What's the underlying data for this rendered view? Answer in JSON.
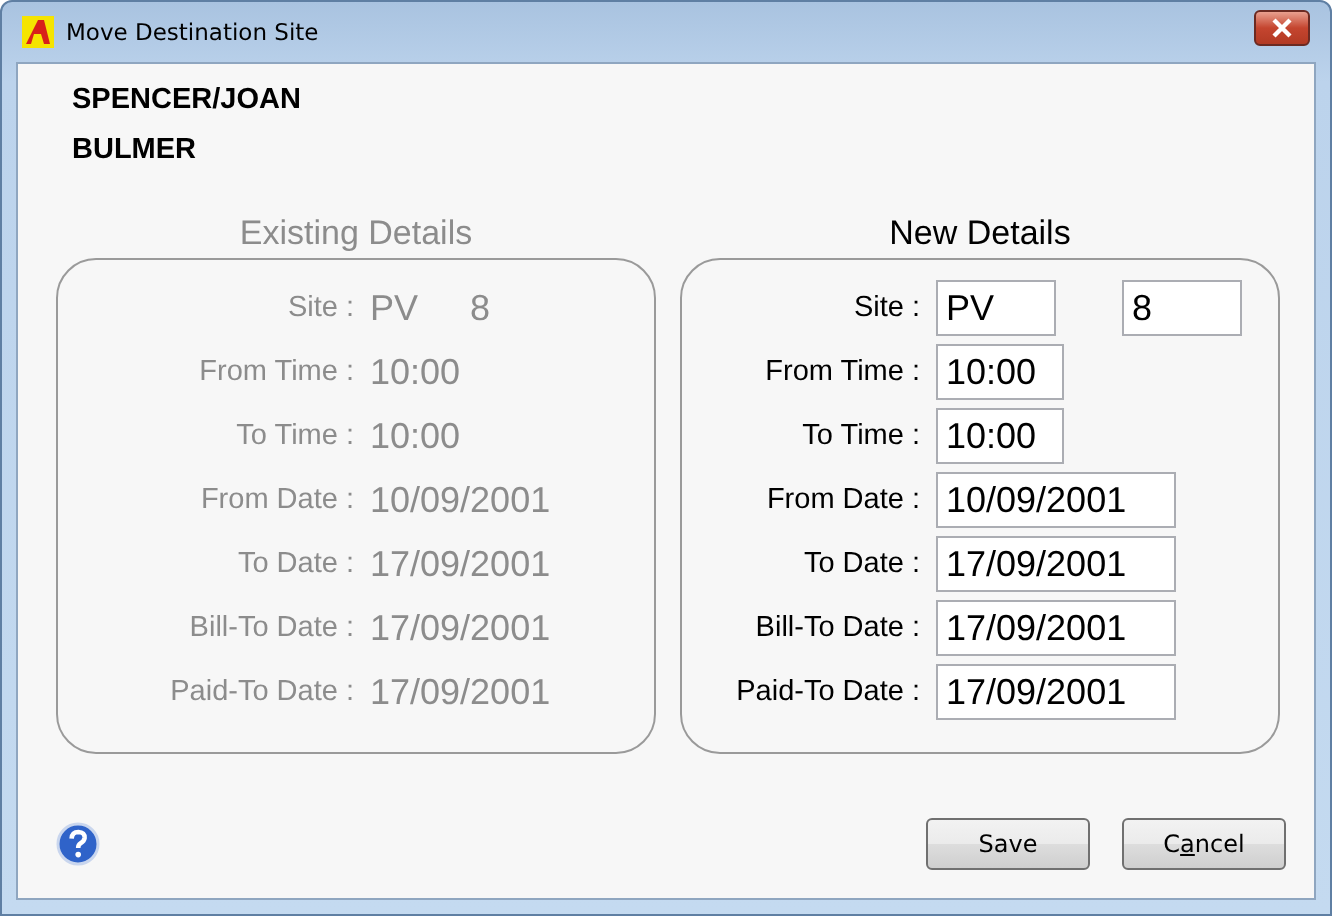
{
  "window": {
    "title": "Move Destination Site"
  },
  "customer": [
    "SPENCER/JOAN",
    "BULMER"
  ],
  "existing_details": {
    "heading": "Existing Details",
    "disabled": true,
    "rows": [
      {
        "label": "Site :",
        "values": [
          "PV",
          "8"
        ]
      },
      {
        "label": "From Time :",
        "values": [
          "10:00"
        ]
      },
      {
        "label": "To Time :",
        "values": [
          "10:00"
        ]
      },
      {
        "label": "From Date :",
        "values": [
          "10/09/2001"
        ]
      },
      {
        "label": "To Date :",
        "values": [
          "17/09/2001"
        ]
      },
      {
        "label": "Bill-To Date :",
        "values": [
          "17/09/2001"
        ]
      },
      {
        "label": "Paid-To Date :",
        "values": [
          "17/09/2001"
        ]
      }
    ]
  },
  "new_details": {
    "heading": "New Details",
    "rows": [
      {
        "label": "Site :",
        "fields": [
          {
            "value": "PV",
            "kind": "short"
          },
          {
            "value": "8",
            "kind": "short"
          }
        ]
      },
      {
        "label": "From Time :",
        "fields": [
          {
            "value": "10:00",
            "kind": "time"
          }
        ]
      },
      {
        "label": "To Time :",
        "fields": [
          {
            "value": "10:00",
            "kind": "time"
          }
        ]
      },
      {
        "label": "From Date :",
        "fields": [
          {
            "value": "10/09/2001",
            "kind": "date"
          }
        ]
      },
      {
        "label": "To Date :",
        "fields": [
          {
            "value": "17/09/2001",
            "kind": "date"
          }
        ]
      },
      {
        "label": "Bill-To Date :",
        "fields": [
          {
            "value": "17/09/2001",
            "kind": "date"
          }
        ]
      },
      {
        "label": "Paid-To Date :",
        "fields": [
          {
            "value": "17/09/2001",
            "kind": "date"
          }
        ]
      }
    ]
  },
  "buttons": [
    {
      "label": [
        {
          "text": "Save",
          "underlined": false
        }
      ]
    },
    {
      "label": [
        {
          "text": "C",
          "underlined": false
        },
        {
          "text": "a",
          "underlined": true
        },
        {
          "text": "ncel",
          "underlined": false
        }
      ]
    }
  ]
}
